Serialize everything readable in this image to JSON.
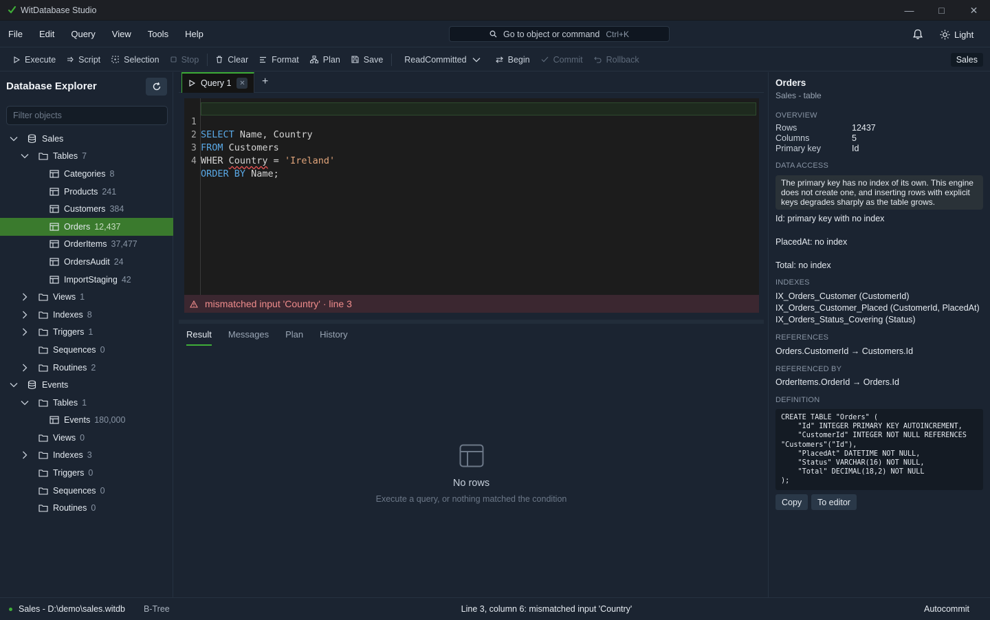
{
  "window": {
    "title": "WitDatabase Studio"
  },
  "menu": [
    "File",
    "Edit",
    "Query",
    "View",
    "Tools",
    "Help"
  ],
  "command_palette": {
    "label": "Go to object or command",
    "shortcut": "Ctrl+K"
  },
  "theme_toggle": "Light",
  "toolbar": {
    "execute": "Execute",
    "script": "Script",
    "selection": "Selection",
    "stop": "Stop",
    "clear": "Clear",
    "format": "Format",
    "plan": "Plan",
    "save": "Save",
    "isolation": "ReadCommitted",
    "begin": "Begin",
    "commit": "Commit",
    "rollback": "Rollback",
    "database": "Sales"
  },
  "sidebar": {
    "title": "Database Explorer",
    "filter_placeholder": "Filter objects",
    "tree": [
      {
        "label": "Sales",
        "count": ""
      },
      {
        "label": "Tables",
        "count": "7"
      },
      {
        "label": "Categories",
        "count": "8"
      },
      {
        "label": "Products",
        "count": "241"
      },
      {
        "label": "Customers",
        "count": "384"
      },
      {
        "label": "Orders",
        "count": "12,437"
      },
      {
        "label": "OrderItems",
        "count": "37,477"
      },
      {
        "label": "OrdersAudit",
        "count": "24"
      },
      {
        "label": "ImportStaging",
        "count": "42"
      },
      {
        "label": "Views",
        "count": "1"
      },
      {
        "label": "Indexes",
        "count": "8"
      },
      {
        "label": "Triggers",
        "count": "1"
      },
      {
        "label": "Sequences",
        "count": "0"
      },
      {
        "label": "Routines",
        "count": "2"
      },
      {
        "label": "Events",
        "count": ""
      },
      {
        "label": "Tables",
        "count": "1"
      },
      {
        "label": "Events",
        "count": "180,000"
      },
      {
        "label": "Views",
        "count": "0"
      },
      {
        "label": "Indexes",
        "count": "3"
      },
      {
        "label": "Triggers",
        "count": "0"
      },
      {
        "label": "Sequences",
        "count": "0"
      },
      {
        "label": "Routines",
        "count": "0"
      }
    ]
  },
  "editor": {
    "tab": "Query 1",
    "lines": [
      {
        "num": "1",
        "kw1": "SELECT",
        "rest1": " Name, Country"
      },
      {
        "num": "2",
        "kw1": "FROM",
        "rest1": " Customers"
      },
      {
        "num": "3",
        "a": "WHER ",
        "b": "Country",
        "c": " = ",
        "str": "'Ireland'"
      },
      {
        "num": "4",
        "kw1": "ORDER BY",
        "rest1": " Name;"
      }
    ],
    "error": "mismatched input 'Country' · line 3"
  },
  "results": {
    "tabs": [
      "Result",
      "Messages",
      "Plan",
      "History"
    ],
    "empty_title": "No rows",
    "empty_hint": "Execute a query, or nothing matched the condition"
  },
  "inspector": {
    "title": "Orders",
    "subtitle": "Sales - table",
    "overview_label": "OVERVIEW",
    "rows_label": "Rows",
    "rows_value": "12437",
    "columns_label": "Columns",
    "columns_value": "5",
    "pk_label": "Primary key",
    "pk_value": "Id",
    "access_label": "DATA ACCESS",
    "access_note": "The primary key has no index of its own. This engine does not create one, and inserting rows with explicit keys degrades sharply as the table grows.",
    "access_items": [
      "Id: primary key with no index",
      "PlacedAt: no index",
      "Total: no index"
    ],
    "indexes_label": "INDEXES",
    "indexes": [
      "IX_Orders_Customer (CustomerId)",
      "IX_Orders_Customer_Placed (CustomerId, PlacedAt)",
      "IX_Orders_Status_Covering (Status)"
    ],
    "references_label": "REFERENCES",
    "references": "Orders.CustomerId → Customers.Id",
    "referenced_by_label": "REFERENCED BY",
    "referenced_by": "OrderItems.OrderId → Orders.Id",
    "definition_label": "DEFINITION",
    "definition": "CREATE TABLE \"Orders\" (\n    \"Id\" INTEGER PRIMARY KEY AUTOINCREMENT,\n    \"CustomerId\" INTEGER NOT NULL REFERENCES\n\"Customers\"(\"Id\"),\n    \"PlacedAt\" DATETIME NOT NULL,\n    \"Status\" VARCHAR(16) NOT NULL,\n    \"Total\" DECIMAL(18,2) NOT NULL\n);",
    "copy_label": "Copy",
    "to_editor_label": "To editor"
  },
  "status": {
    "connection": "Sales - D:\\demo\\sales.witdb",
    "engine": "B-Tree",
    "message": "Line 3, column 6: mismatched input 'Country'",
    "mode": "Autocommit"
  },
  "colors": {
    "accent": "#3fae38",
    "selection": "#3a7a2d",
    "background": "#1b2431",
    "error": "#f08c8c"
  }
}
